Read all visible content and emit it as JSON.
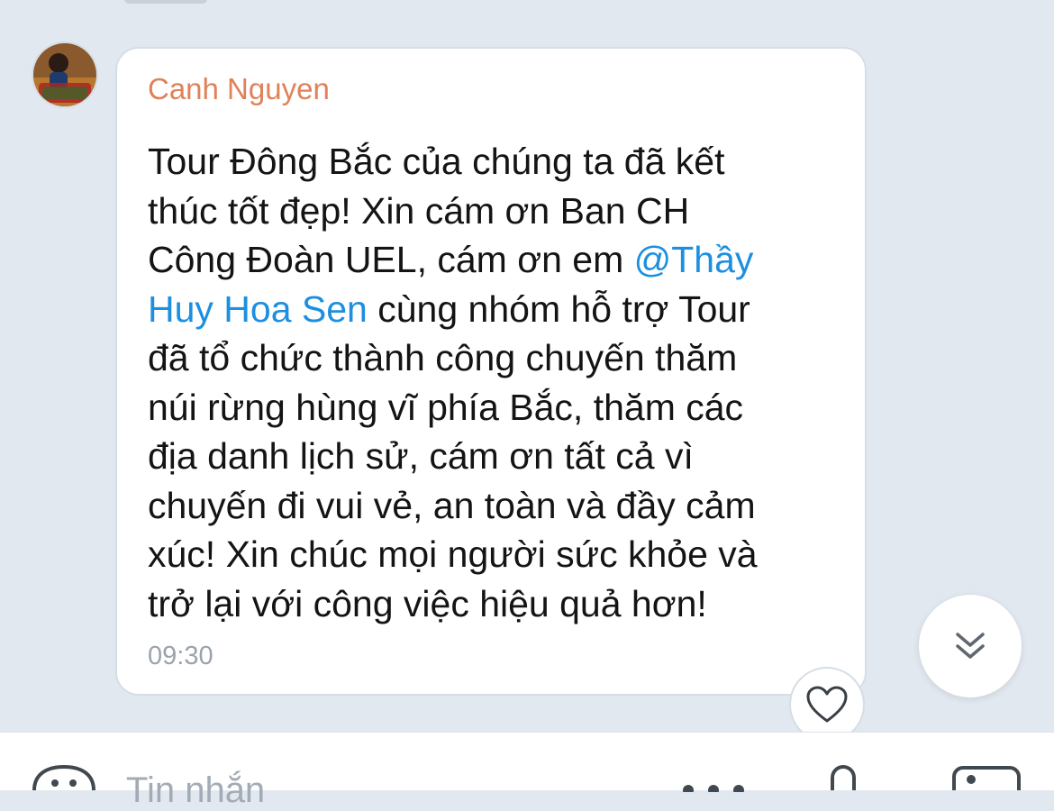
{
  "message": {
    "sender": "Canh Nguyen",
    "lines": [
      [
        "Tour Đông Bắc của chúng ta đã kết"
      ],
      [
        "thúc tốt đẹp! Xin cám ơn Ban CH"
      ],
      [
        "Công Đoàn UEL, cám ơn em ",
        {
          "mention": "@Thầy"
        }
      ],
      [
        {
          "mention": "Huy Hoa Sen"
        },
        " cùng nhóm hỗ trợ Tour"
      ],
      [
        "đã tổ chức thành công chuyến thăm"
      ],
      [
        "núi rừng hùng vĩ phía Bắc, thăm các"
      ],
      [
        "địa danh lịch sử, cám ơn tất cả vì"
      ],
      [
        "chuyến đi vui vẻ, an toàn và đầy cảm"
      ],
      [
        "xúc! Xin chúc mọi người sức khỏe và"
      ],
      [
        "trở lại với công việc hiệu quả hơn!"
      ]
    ],
    "time": "09:30"
  },
  "composer": {
    "placeholder": "Tin nhắn"
  },
  "icons": {
    "avatar": "avatar-image",
    "react": "heart-icon",
    "scroll": "double-chevron-down-icon",
    "sticker": "emoji-icon",
    "more": "more-icon",
    "mic": "microphone-icon",
    "image": "image-icon"
  },
  "colors": {
    "sender": "#e0815a",
    "mention": "#1d8fe0",
    "background": "#e2e8f0"
  }
}
